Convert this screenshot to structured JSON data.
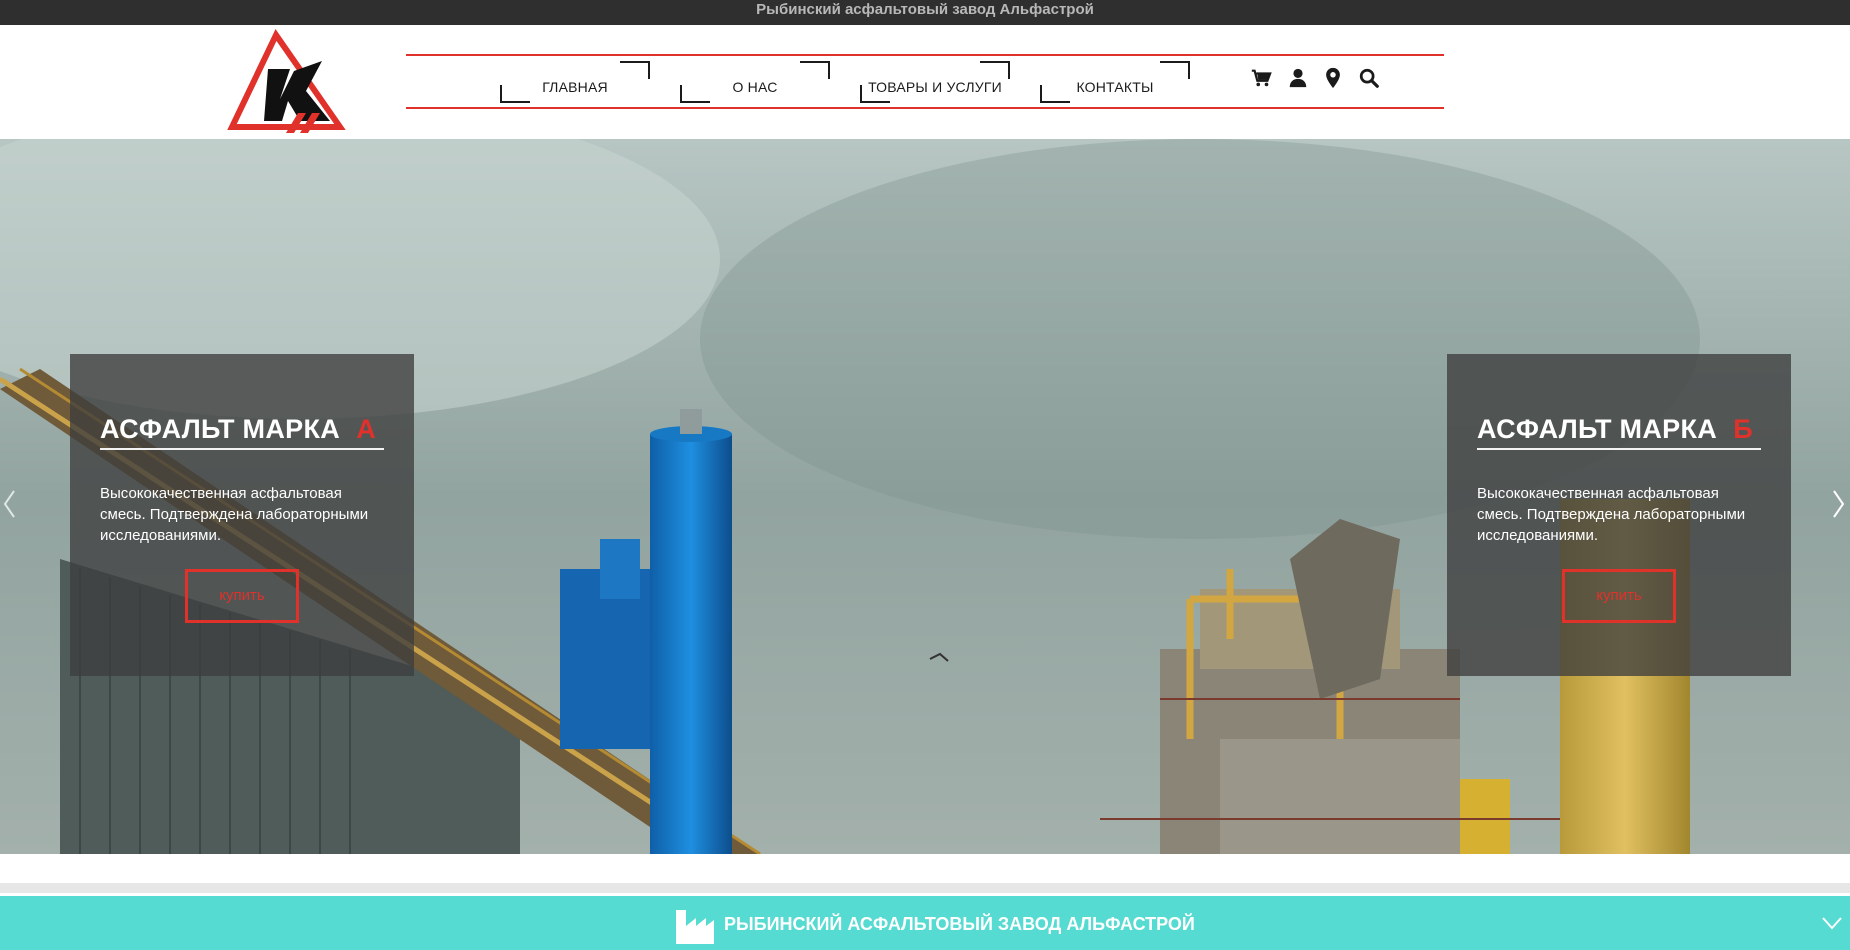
{
  "topbar": {
    "title": "Рыбинский асфальтовый завод Альфастрой"
  },
  "header": {
    "logo_icon": "alfastroy-logo",
    "nav": [
      {
        "label": "ГЛАВНАЯ"
      },
      {
        "label": "О НАС"
      },
      {
        "label": "ТОВАРЫ И УСЛУГИ"
      },
      {
        "label": "КОНТАКТЫ"
      }
    ],
    "tools": [
      "cart-icon",
      "user-icon",
      "location-pin-icon",
      "search-icon"
    ]
  },
  "hero": {
    "slides": [
      {
        "title": "АСФАЛЬТ МАРКА",
        "mark": "А",
        "description": "Высококачественная асфальтовая смесь. Подтверждена лабораторными исследованиями.",
        "button": "купить"
      },
      {
        "title": "АСФАЛЬТ МАРКА",
        "mark": "Б",
        "description": "Высококачественная асфальтовая смесь. Подтверждена лабораторными исследованиями.",
        "button": "купить"
      }
    ],
    "prev_icon": "chevron-left-icon",
    "next_icon": "chevron-right-icon"
  },
  "footer": {
    "title": "РЫБИНСКИЙ АСФАЛЬТОВЫЙ ЗАВОД АЛЬФАСТРОЙ",
    "icon": "factory-icon",
    "toggle_icon": "chevron-down-icon"
  },
  "colors": {
    "accent": "#e0312b",
    "topbar": "#2f2f2f",
    "footer": "#55dbd1",
    "card": "#3e3e3e"
  }
}
